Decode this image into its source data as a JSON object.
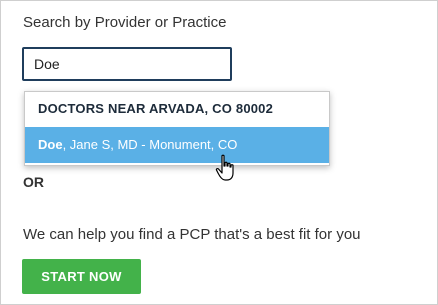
{
  "search": {
    "label": "Search by Provider or Practice",
    "value": "Doe"
  },
  "dropdown": {
    "header": "DOCTORS NEAR ARVADA, CO 80002",
    "option": {
      "match": "Doe",
      "rest": ", Jane S, MD - Monument, CO"
    }
  },
  "or_label": "OR",
  "help_text": "We can help you find a PCP that's a best fit for you",
  "start_button": "START NOW",
  "colors": {
    "highlight": "#5ab0e6",
    "button": "#43b24a",
    "input_border": "#1f3d5c"
  },
  "icons": {
    "cursor": "hand-pointer-icon"
  }
}
